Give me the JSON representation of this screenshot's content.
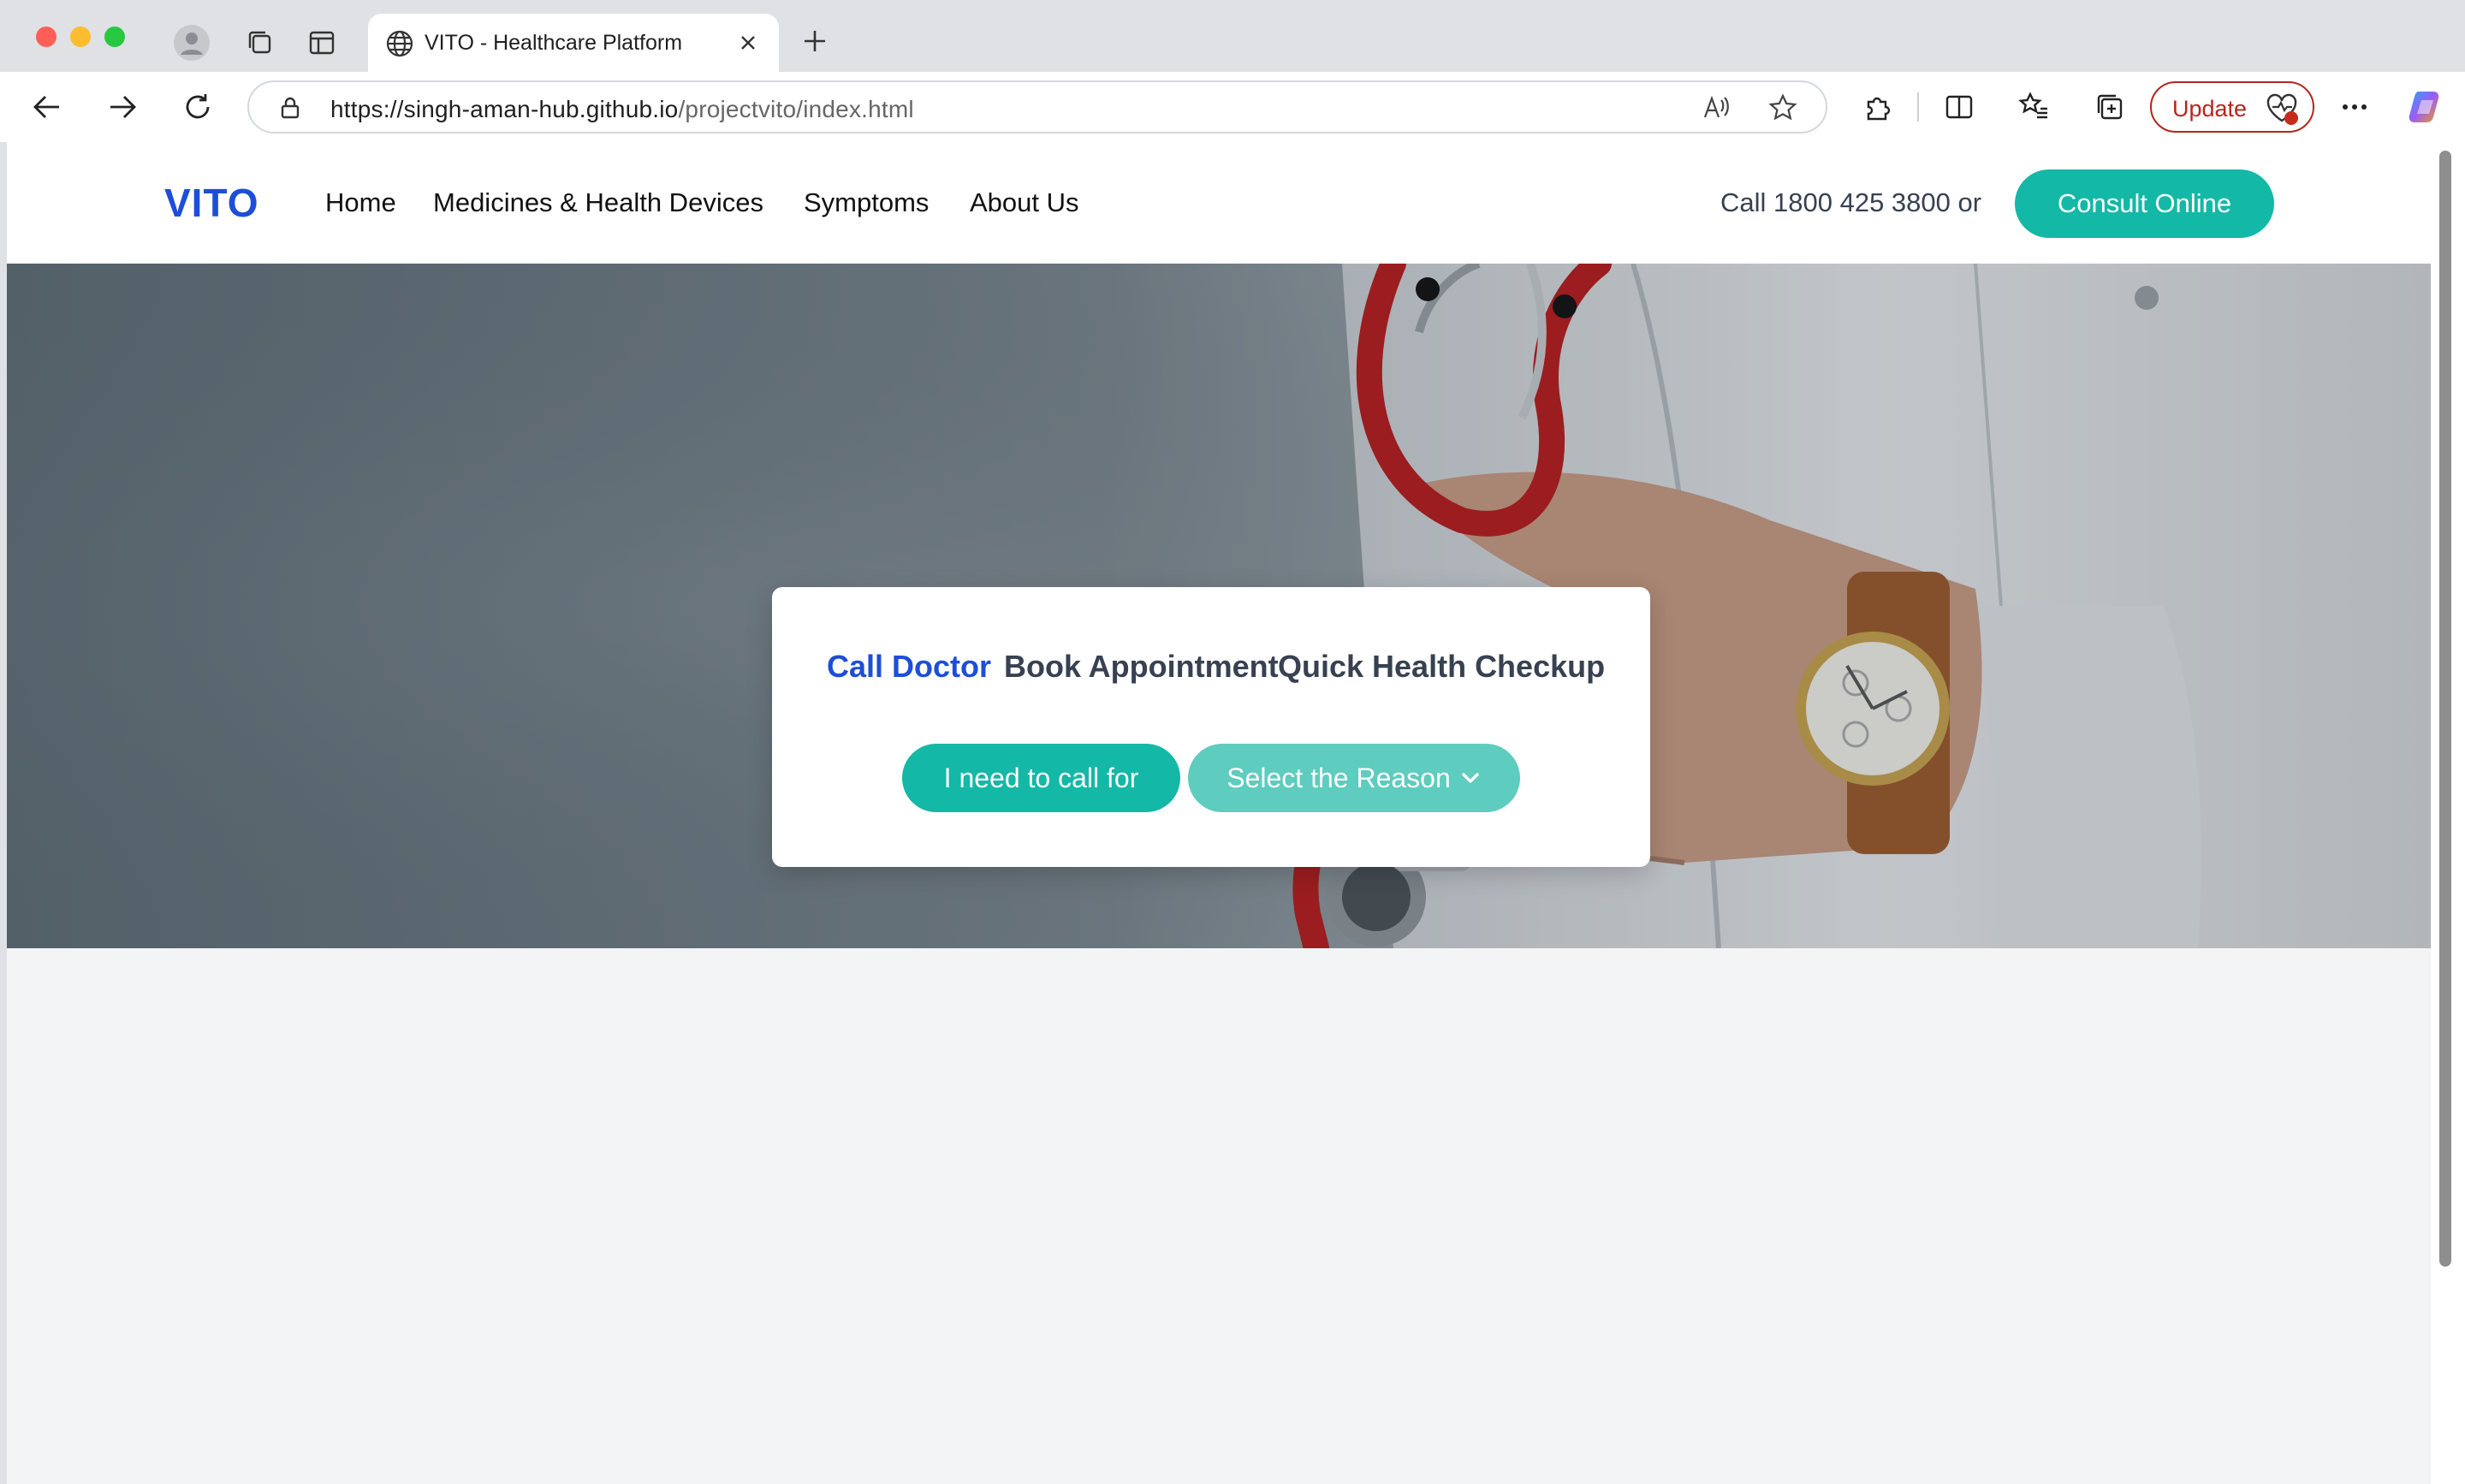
{
  "browser": {
    "tab_title": "VITO - Healthcare Platform",
    "url_host": "https://singh-aman-hub.github.io",
    "url_path": "/projectvito/index.html",
    "update_label": "Update",
    "colors": {
      "update": "#b3261e",
      "tabbar": "#dfe1e5"
    }
  },
  "site": {
    "logo": "VITO",
    "nav": [
      "Home",
      "Medicines & Health Devices",
      "Symptoms",
      "About Us"
    ],
    "call_text": "Call 1800 425 3800 or",
    "consult_label": "Consult Online",
    "colors": {
      "brand": "#1d4ed8",
      "accent": "#14b8a6",
      "accent_light": "#5eccbf"
    }
  },
  "card": {
    "tabs": [
      "Call Doctor",
      "Book Appointment",
      "Quick Health Checkup"
    ],
    "active_tab": "Call Doctor",
    "call_for_label": "I need to call for",
    "reason_select": "Select the Reason"
  }
}
